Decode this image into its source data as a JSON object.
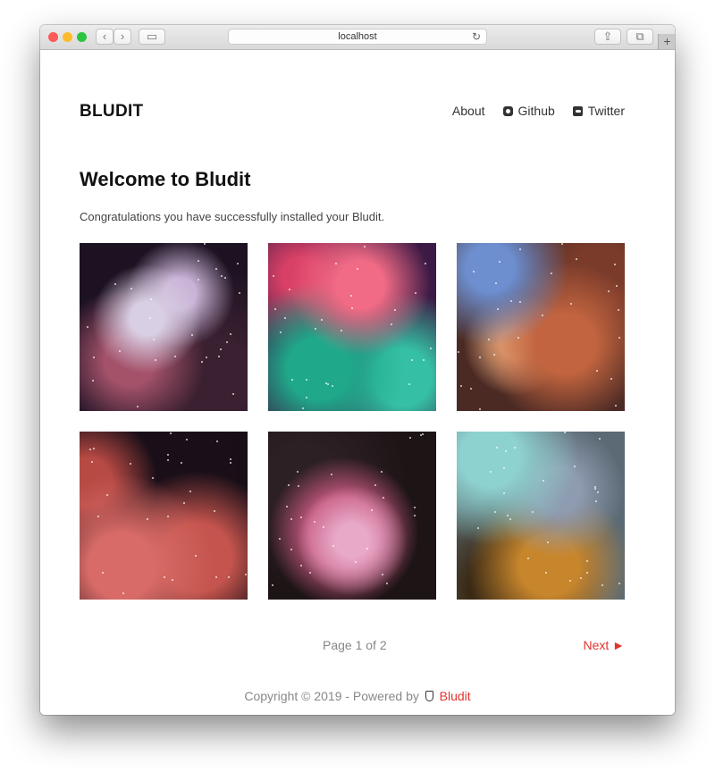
{
  "browser": {
    "address": "localhost"
  },
  "site": {
    "brand": "BLUDIT",
    "nav": [
      {
        "label": "About",
        "icon": "none"
      },
      {
        "label": "Github",
        "icon": "github-icon"
      },
      {
        "label": "Twitter",
        "icon": "twitter-icon"
      }
    ]
  },
  "page": {
    "title": "Welcome to Bludit",
    "lead": "Congratulations you have successfully installed your Bludit."
  },
  "gallery": {
    "images": [
      "nebula-1",
      "nebula-2",
      "nebula-3",
      "nebula-4",
      "nebula-5",
      "nebula-6"
    ]
  },
  "pagination": {
    "info": "Page 1 of 2",
    "next": "Next ►"
  },
  "footer": {
    "text": "Copyright © 2019 - Powered by",
    "link": "Bludit"
  },
  "colors": {
    "accent": "#e3322c"
  }
}
